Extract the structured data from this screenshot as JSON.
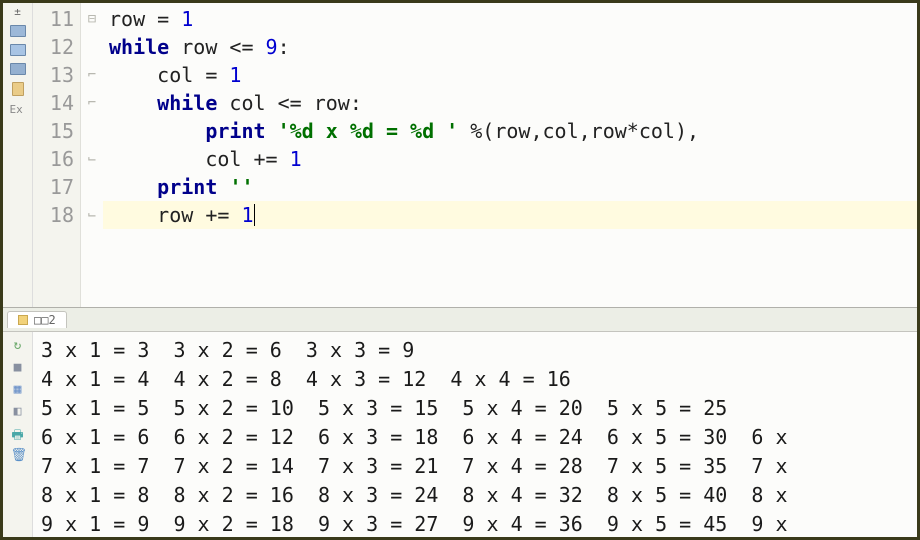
{
  "editor": {
    "current_line_index": 7,
    "lines": [
      {
        "lineno": 11,
        "fold": "minus",
        "tokens": [
          {
            "t": "row = ",
            "c": ""
          },
          {
            "t": "1",
            "c": "num"
          }
        ]
      },
      {
        "lineno": 12,
        "fold": "none",
        "tokens": [
          {
            "t": "while",
            "c": "kw"
          },
          {
            "t": " row <= ",
            "c": ""
          },
          {
            "t": "9",
            "c": "num"
          },
          {
            "t": ":",
            "c": ""
          }
        ]
      },
      {
        "lineno": 13,
        "fold": "top",
        "tokens": [
          {
            "t": "    col = ",
            "c": ""
          },
          {
            "t": "1",
            "c": "num"
          }
        ]
      },
      {
        "lineno": 14,
        "fold": "top",
        "tokens": [
          {
            "t": "    ",
            "c": ""
          },
          {
            "t": "while",
            "c": "kw"
          },
          {
            "t": " col <= row:",
            "c": ""
          }
        ]
      },
      {
        "lineno": 15,
        "fold": "none",
        "tokens": [
          {
            "t": "        ",
            "c": ""
          },
          {
            "t": "print",
            "c": "kw"
          },
          {
            "t": " ",
            "c": ""
          },
          {
            "t": "'%d x %d = %d '",
            "c": "str"
          },
          {
            "t": " %(row,col,row*col),",
            "c": ""
          }
        ]
      },
      {
        "lineno": 16,
        "fold": "bot",
        "tokens": [
          {
            "t": "        col += ",
            "c": ""
          },
          {
            "t": "1",
            "c": "num"
          }
        ]
      },
      {
        "lineno": 17,
        "fold": "none",
        "tokens": [
          {
            "t": "    ",
            "c": ""
          },
          {
            "t": "print",
            "c": "kw"
          },
          {
            "t": " ",
            "c": ""
          },
          {
            "t": "''",
            "c": "str"
          }
        ]
      },
      {
        "lineno": 18,
        "fold": "bot",
        "tokens": [
          {
            "t": "    row += ",
            "c": ""
          },
          {
            "t": "1",
            "c": "num"
          }
        ],
        "caret_after": true
      }
    ]
  },
  "tab": {
    "label": "□□2"
  },
  "console_lines": [
    "3 x 1 = 3  3 x 2 = 6  3 x 3 = 9  ",
    "4 x 1 = 4  4 x 2 = 8  4 x 3 = 12  4 x 4 = 16  ",
    "5 x 1 = 5  5 x 2 = 10  5 x 3 = 15  5 x 4 = 20  5 x 5 = 25  ",
    "6 x 1 = 6  6 x 2 = 12  6 x 3 = 18  6 x 4 = 24  6 x 5 = 30  6 x ",
    "7 x 1 = 7  7 x 2 = 14  7 x 3 = 21  7 x 4 = 28  7 x 5 = 35  7 x ",
    "8 x 1 = 8  8 x 2 = 16  8 x 3 = 24  8 x 4 = 32  8 x 5 = 40  8 x ",
    "9 x 1 = 9  9 x 2 = 18  9 x 3 = 27  9 x 4 = 36  9 x 5 = 45  9 x "
  ]
}
